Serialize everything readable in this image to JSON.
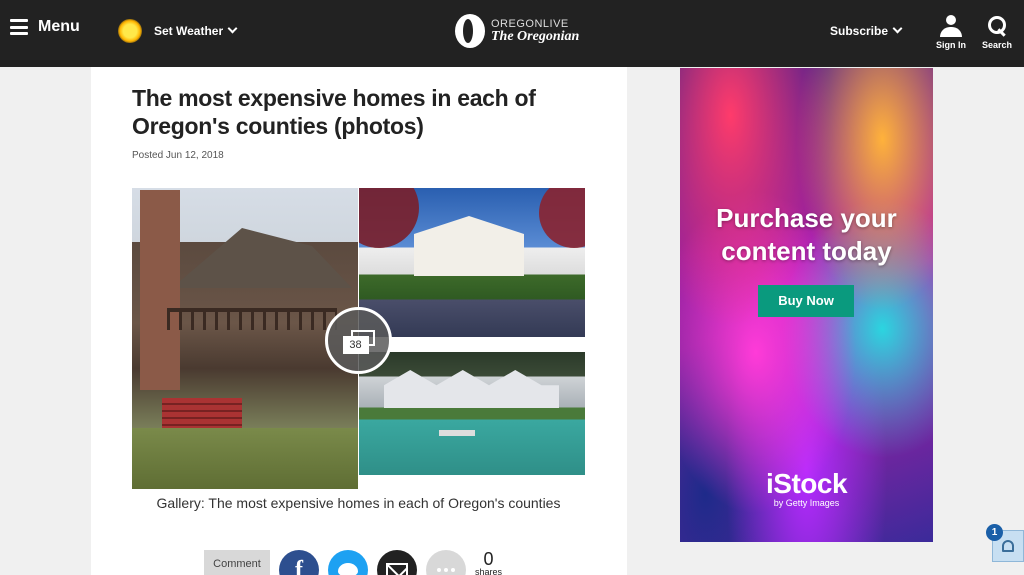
{
  "header": {
    "menu_label": "Menu",
    "weather_label": "Set Weather",
    "logo_top": "OREGONLIVE",
    "logo_bottom": "The Oregonian",
    "subscribe_label": "Subscribe",
    "signin_label": "Sign In",
    "search_label": "Search"
  },
  "article": {
    "title": "The most expensive homes in each of Oregon's counties (photos)",
    "posted": "Posted Jun 12, 2018",
    "gallery_count": "38",
    "caption": "Gallery: The most expensive homes in each of Oregon's counties"
  },
  "share": {
    "comment_label": "Comment",
    "facebook_glyph": "f",
    "share_count": "0",
    "shares_label": "shares"
  },
  "ad": {
    "headline": "Purchase your content today",
    "button_label": "Buy Now",
    "brand": "iStock",
    "brand_sub": "by Getty Images"
  },
  "notifications": {
    "count": "1"
  },
  "colors": {
    "header_bg": "#222222",
    "facebook": "#2d4f8f",
    "twitter": "#1da1f2",
    "ad_button": "#0a9a7e"
  }
}
